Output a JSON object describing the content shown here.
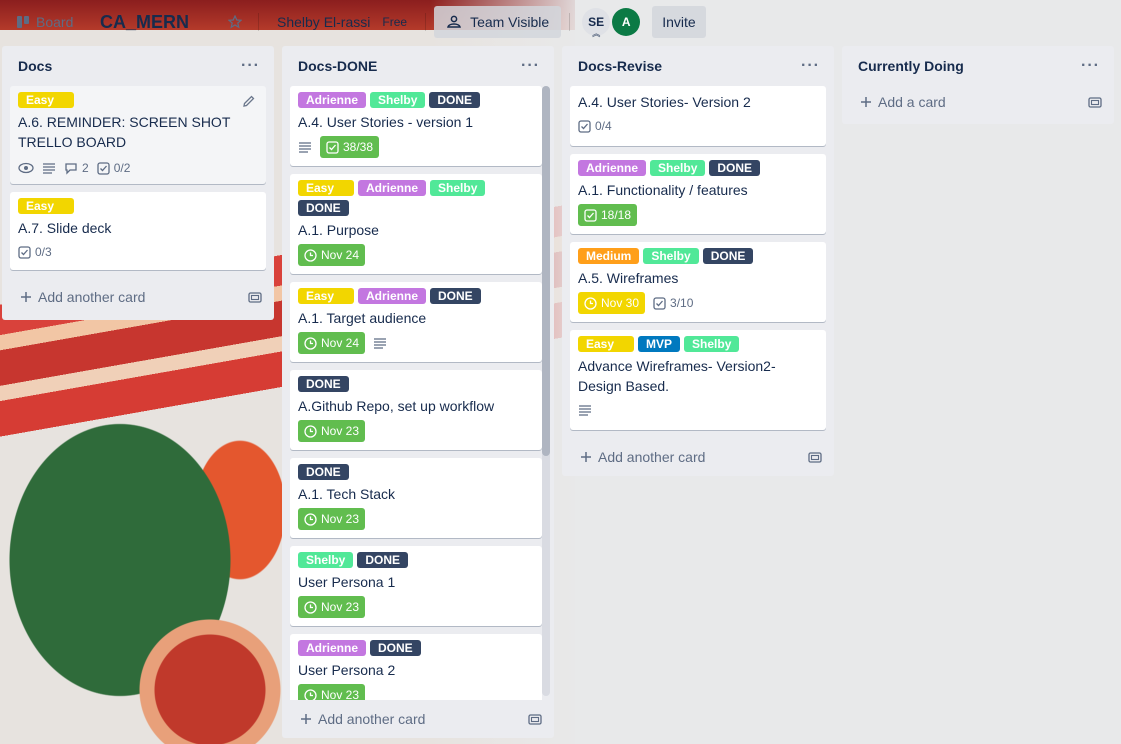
{
  "header": {
    "board_label": "Board",
    "board_title": "CA_MERN",
    "team_name": "Shelby El-rassi",
    "team_plan": "Free",
    "visibility_label": "Team Visible",
    "avatar_se": "SE",
    "avatar_a": "A",
    "invite_label": "Invite"
  },
  "colors": {
    "yellow": "#f2d600",
    "purple": "#c377e0",
    "green": "#51e898",
    "dark": "#344563",
    "orange": "#ff9f1a",
    "blue": "#0079bf",
    "due_green": "#61bd4f"
  },
  "lists": [
    {
      "title": "Docs",
      "add_label": "Add another card",
      "cards": [
        {
          "labels": [
            "Easy"
          ],
          "title": "A.6. REMINDER: SCREEN SHOT TRELLO BOARD",
          "comments": "2",
          "checklist": "0/2"
        },
        {
          "labels": [
            "Easy"
          ],
          "title": "A.7. Slide deck",
          "checklist": "0/3"
        }
      ]
    },
    {
      "title": "Docs-DONE",
      "add_label": "Add another card",
      "cards": [
        {
          "labels": [
            "Adrienne",
            "Shelby",
            "DONE"
          ],
          "title": "A.4. User Stories - version 1",
          "checklist": "38/38"
        },
        {
          "labels": [
            "Easy",
            "Adrienne",
            "Shelby",
            "DONE"
          ],
          "title": "A.1. Purpose",
          "due": "Nov 24"
        },
        {
          "labels": [
            "Easy",
            "Adrienne",
            "DONE"
          ],
          "title": "A.1. Target audience",
          "due": "Nov 24"
        },
        {
          "labels": [
            "DONE"
          ],
          "title": "A.Github Repo, set up workflow",
          "due": "Nov 23"
        },
        {
          "labels": [
            "DONE"
          ],
          "title": "A.1. Tech Stack",
          "due": "Nov 23"
        },
        {
          "labels": [
            "Shelby",
            "DONE"
          ],
          "title": "User Persona 1",
          "due": "Nov 23"
        },
        {
          "labels": [
            "Adrienne",
            "DONE"
          ],
          "title": "User Persona 2",
          "due": "Nov 23"
        }
      ]
    },
    {
      "title": "Docs-Revise",
      "add_label": "Add another card",
      "cards": [
        {
          "labels": [],
          "title": "A.4. User Stories- Version 2",
          "checklist": "0/4"
        },
        {
          "labels": [
            "Adrienne",
            "Shelby",
            "DONE"
          ],
          "title": "A.1. Functionality / features",
          "checklist": "18/18"
        },
        {
          "labels": [
            "Medium",
            "Shelby",
            "DONE"
          ],
          "title": "A.5. Wireframes",
          "due": "Nov 30",
          "checklist": "3/10"
        },
        {
          "labels": [
            "Easy",
            "MVP",
            "Shelby"
          ],
          "title": "Advance Wireframes- Version2- Design Based."
        }
      ]
    },
    {
      "title": "Currently Doing",
      "add_label": "Add a card",
      "cards": []
    }
  ]
}
